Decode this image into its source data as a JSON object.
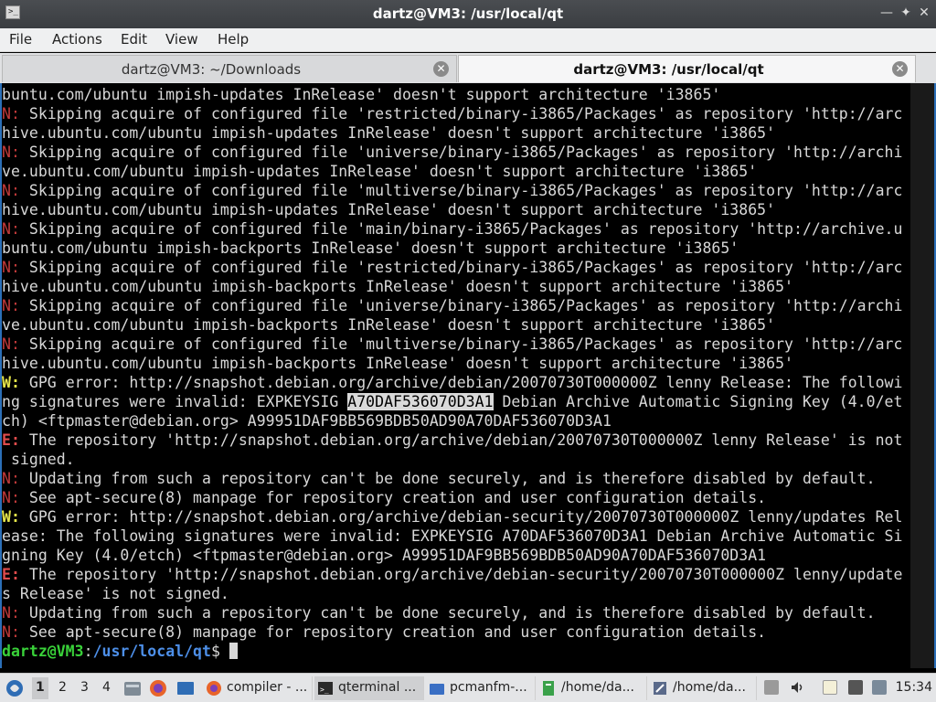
{
  "window": {
    "title": "dartz@VM3: /usr/local/qt",
    "icon": "terminal-icon",
    "controls": [
      "minimize",
      "maximize",
      "close"
    ]
  },
  "menu": [
    "File",
    "Actions",
    "Edit",
    "View",
    "Help"
  ],
  "tabs": [
    {
      "label": "dartz@VM3: ~/Downloads",
      "active": false
    },
    {
      "label": "dartz@VM3: /usr/local/qt",
      "active": true
    }
  ],
  "terminal": {
    "lines": [
      {
        "segments": [
          {
            "t": "buntu.com/ubuntu impish-updates InRelease' doesn't support architecture 'i3865'",
            "c": ""
          }
        ]
      },
      {
        "segments": [
          {
            "t": "N:",
            "c": "n"
          },
          {
            "t": " Skipping acquire of configured file 'restricted/binary-i3865/Packages' as repository 'http://arc",
            "c": ""
          }
        ]
      },
      {
        "segments": [
          {
            "t": "hive.ubuntu.com/ubuntu impish-updates InRelease' doesn't support architecture 'i3865'",
            "c": ""
          }
        ]
      },
      {
        "segments": [
          {
            "t": "N:",
            "c": "n"
          },
          {
            "t": " Skipping acquire of configured file 'universe/binary-i3865/Packages' as repository 'http://archi",
            "c": ""
          }
        ]
      },
      {
        "segments": [
          {
            "t": "ve.ubuntu.com/ubuntu impish-updates InRelease' doesn't support architecture 'i3865'",
            "c": ""
          }
        ]
      },
      {
        "segments": [
          {
            "t": "N:",
            "c": "n"
          },
          {
            "t": " Skipping acquire of configured file 'multiverse/binary-i3865/Packages' as repository 'http://arc",
            "c": ""
          }
        ]
      },
      {
        "segments": [
          {
            "t": "hive.ubuntu.com/ubuntu impish-updates InRelease' doesn't support architecture 'i3865'",
            "c": ""
          }
        ]
      },
      {
        "segments": [
          {
            "t": "N:",
            "c": "n"
          },
          {
            "t": " Skipping acquire of configured file 'main/binary-i3865/Packages' as repository 'http://archive.u",
            "c": ""
          }
        ]
      },
      {
        "segments": [
          {
            "t": "buntu.com/ubuntu impish-backports InRelease' doesn't support architecture 'i3865'",
            "c": ""
          }
        ]
      },
      {
        "segments": [
          {
            "t": "N:",
            "c": "n"
          },
          {
            "t": " Skipping acquire of configured file 'restricted/binary-i3865/Packages' as repository 'http://arc",
            "c": ""
          }
        ]
      },
      {
        "segments": [
          {
            "t": "hive.ubuntu.com/ubuntu impish-backports InRelease' doesn't support architecture 'i3865'",
            "c": ""
          }
        ]
      },
      {
        "segments": [
          {
            "t": "N:",
            "c": "n"
          },
          {
            "t": " Skipping acquire of configured file 'universe/binary-i3865/Packages' as repository 'http://archi",
            "c": ""
          }
        ]
      },
      {
        "segments": [
          {
            "t": "ve.ubuntu.com/ubuntu impish-backports InRelease' doesn't support architecture 'i3865'",
            "c": ""
          }
        ]
      },
      {
        "segments": [
          {
            "t": "N:",
            "c": "n"
          },
          {
            "t": " Skipping acquire of configured file 'multiverse/binary-i3865/Packages' as repository 'http://arc",
            "c": ""
          }
        ]
      },
      {
        "segments": [
          {
            "t": "hive.ubuntu.com/ubuntu impish-backports InRelease' doesn't support architecture 'i3865'",
            "c": ""
          }
        ]
      },
      {
        "segments": [
          {
            "t": "W:",
            "c": "w"
          },
          {
            "t": " GPG error: http://snapshot.debian.org/archive/debian/20070730T000000Z lenny Release: The followi",
            "c": ""
          }
        ]
      },
      {
        "segments": [
          {
            "t": "ng signatures were invalid: EXPKEYSIG ",
            "c": ""
          },
          {
            "t": "A70DAF536070D3A1",
            "c": "hl"
          },
          {
            "t": " Debian Archive Automatic Signing Key (4.0/et",
            "c": ""
          }
        ]
      },
      {
        "segments": [
          {
            "t": "ch) <ftpmaster@debian.org> A99951DAF9BB569BDB50AD90A70DAF536070D3A1",
            "c": ""
          }
        ]
      },
      {
        "segments": [
          {
            "t": "E:",
            "c": "e"
          },
          {
            "t": " The repository 'http://snapshot.debian.org/archive/debian/20070730T000000Z lenny Release' is not",
            "c": ""
          }
        ]
      },
      {
        "segments": [
          {
            "t": " signed.",
            "c": ""
          }
        ]
      },
      {
        "segments": [
          {
            "t": "N:",
            "c": "n"
          },
          {
            "t": " Updating from such a repository can't be done securely, and is therefore disabled by default.",
            "c": ""
          }
        ]
      },
      {
        "segments": [
          {
            "t": "N:",
            "c": "n"
          },
          {
            "t": " See apt-secure(8) manpage for repository creation and user configuration details.",
            "c": ""
          }
        ]
      },
      {
        "segments": [
          {
            "t": "W:",
            "c": "w"
          },
          {
            "t": " GPG error: http://snapshot.debian.org/archive/debian-security/20070730T000000Z lenny/updates Rel",
            "c": ""
          }
        ]
      },
      {
        "segments": [
          {
            "t": "ease: The following signatures were invalid: EXPKEYSIG A70DAF536070D3A1 Debian Archive Automatic Si",
            "c": ""
          }
        ]
      },
      {
        "segments": [
          {
            "t": "gning Key (4.0/etch) <ftpmaster@debian.org> A99951DAF9BB569BDB50AD90A70DAF536070D3A1",
            "c": ""
          }
        ]
      },
      {
        "segments": [
          {
            "t": "E:",
            "c": "e"
          },
          {
            "t": " The repository 'http://snapshot.debian.org/archive/debian-security/20070730T000000Z lenny/update",
            "c": ""
          }
        ]
      },
      {
        "segments": [
          {
            "t": "s Release' is not signed.",
            "c": ""
          }
        ]
      },
      {
        "segments": [
          {
            "t": "N:",
            "c": "n"
          },
          {
            "t": " Updating from such a repository can't be done securely, and is therefore disabled by default.",
            "c": ""
          }
        ]
      },
      {
        "segments": [
          {
            "t": "N:",
            "c": "n"
          },
          {
            "t": " See apt-secure(8) manpage for repository creation and user configuration details.",
            "c": ""
          }
        ]
      }
    ],
    "prompt": {
      "user": "dartz@VM3",
      "sep": ":",
      "path": "/usr/local/qt",
      "symbol": "$ "
    }
  },
  "taskbar": {
    "workspaces": [
      "1",
      "2",
      "3",
      "4"
    ],
    "active_workspace": "1",
    "tasks": [
      {
        "label": "compiler - ...",
        "icon": "firefox-icon",
        "color": "#e8642a"
      },
      {
        "label": "qterminal ...",
        "icon": "terminal-icon",
        "color": "#2a2a2a"
      },
      {
        "label": "pcmanfm-...",
        "icon": "folder-icon",
        "color": "#3a6fc4"
      },
      {
        "label": "/home/da...",
        "icon": "document-icon",
        "color": "#3aa14a"
      },
      {
        "label": "/home/da...",
        "icon": "text-editor-icon",
        "color": "#5a6a8a"
      }
    ],
    "clock": "15:34",
    "colors": {
      "accent": "#2b6fb8",
      "prompt_user": "#39d239",
      "prompt_path": "#4d8fe8"
    }
  }
}
